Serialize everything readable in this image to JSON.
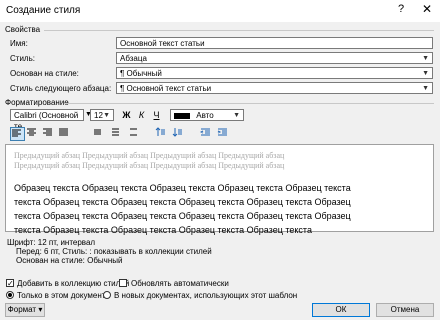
{
  "window": {
    "title": "Создание стиля",
    "help": "?",
    "close": "✕"
  },
  "properties": {
    "section": "Свойства",
    "name_label": "Имя:",
    "name_value": "Основной текст статьи",
    "type_label": "Стиль:",
    "type_value": "Абзаца",
    "based_label": "Основан на стиле:",
    "based_value": "Обычный",
    "next_label": "Стиль следующего абзаца:",
    "next_value": "Основной текст статьи"
  },
  "formatting": {
    "section": "Форматирование",
    "font": "Calibri (Основной те",
    "size": "12",
    "bold": "Ж",
    "italic": "К",
    "underline": "Ч",
    "color": "Авто"
  },
  "preview": {
    "previous_lines": [
      "Предыдущий абзац Предыдущий абзац Предыдущий абзац Предыдущий абзац",
      "Предыдущий абзац Предыдущий абзац Предыдущий абзац Предыдущий абзац"
    ],
    "sample_lines": [
      "Образец текста Образец текста Образец текста Образец текста Образец текста",
      "текста Образец текста Образец текста Образец текста Образец текста Образец",
      "текста Образец текста Образец текста Образец текста Образец текста Образец",
      "текста Образец текста Образец текста Образец текста Образец текста"
    ]
  },
  "description": {
    "line1": "Шрифт: 12 пт, интервал",
    "line2": "Перед:  6 пт, Стиль: : показывать в коллекции стилей",
    "line3": "Основан на стиле: Обычный"
  },
  "options": {
    "add_gallery": "Добавить в коллекцию стилей",
    "auto_update": "Обновлять автоматически",
    "only_doc": "Только в этом документе",
    "new_docs": "В новых документах, использующих этот шаблон"
  },
  "buttons": {
    "format": "Формат ▾",
    "ok": "ОК",
    "cancel": "Отмена"
  }
}
